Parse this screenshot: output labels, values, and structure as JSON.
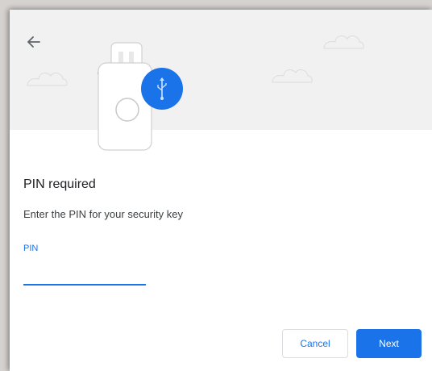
{
  "dialog": {
    "title": "PIN required",
    "subtitle": "Enter the PIN for your security key",
    "pin_field": {
      "label": "PIN",
      "value": ""
    },
    "buttons": {
      "cancel": "Cancel",
      "next": "Next"
    }
  },
  "icons": {
    "back": "arrow-back-icon",
    "security_key": "usb-security-key-icon",
    "usb_badge": "usb-icon"
  },
  "colors": {
    "accent": "#1a73e8",
    "illustration_bg": "#f1f1f1",
    "usb_badge": "#1a73e8"
  }
}
